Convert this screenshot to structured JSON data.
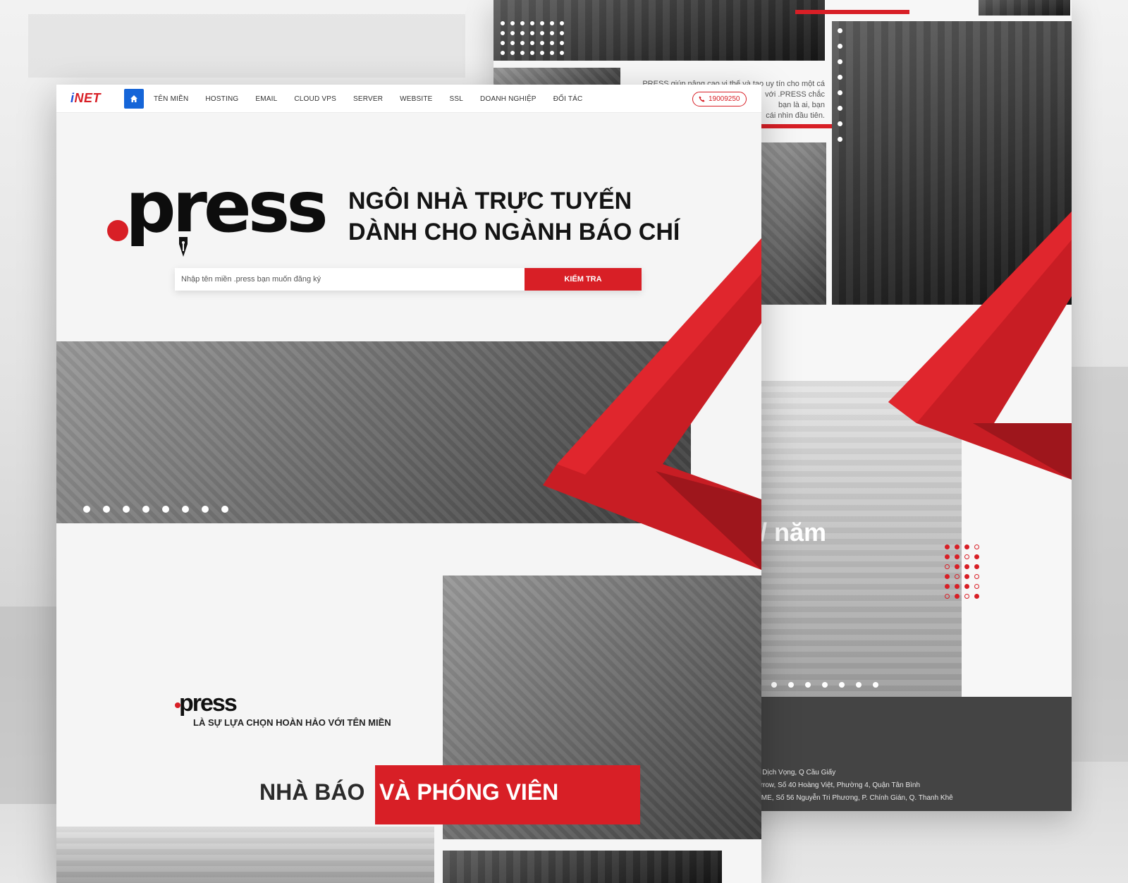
{
  "brand": {
    "logo_i": "i",
    "logo_net": "NET"
  },
  "nav": {
    "items": [
      "TÊN MIỀN",
      "HOSTING",
      "EMAIL",
      "CLOUD VPS",
      "SERVER",
      "WEBSITE",
      "SSL",
      "DOANH NGHIỆP",
      "ĐỐI TÁC"
    ],
    "phone": "19009250"
  },
  "hero": {
    "logo_word": "press",
    "title_line1": "NGÔI NHÀ TRỰC TUYẾN",
    "title_line2": "DÀNH CHO NGÀNH BÁO CHÍ",
    "search_placeholder": "Nhập tên miền .press bạn muốn đăng ký",
    "search_button": "KIỂM TRA"
  },
  "section2": {
    "logo_word": "press",
    "subtitle": "LÀ SỰ LỰA CHỌN HOÀN HẢO VỚI TÊN MIỀN",
    "heading_left": "NHÀ BÁO",
    "heading_right": "VÀ PHÓNG VIÊN"
  },
  "back_panel": {
    "text_lines": [
      ".PRESS giúp nâng cao vị thế và tạo uy tín cho một cá",
      "với .PRESS chắc",
      "bạn là ai, bạn",
      "cái nhìn đầu tiên."
    ],
    "price_suffix": "/ năm",
    "footer_lines": [
      "P Dịch Vọng, Q Cầu Giấy",
      "Arrow, Số 40 Hoàng Việt, Phường 4, Quận Tân Bình",
      "OME, Số 56 Nguyễn Tri Phương, P. Chính Gián, Q. Thanh Khê"
    ]
  },
  "colors": {
    "accent": "#d81f26",
    "nav_blue": "#1565d8",
    "footer": "#444444"
  },
  "icons": [
    "home-icon",
    "phone-icon",
    "pen-nib-icon"
  ]
}
